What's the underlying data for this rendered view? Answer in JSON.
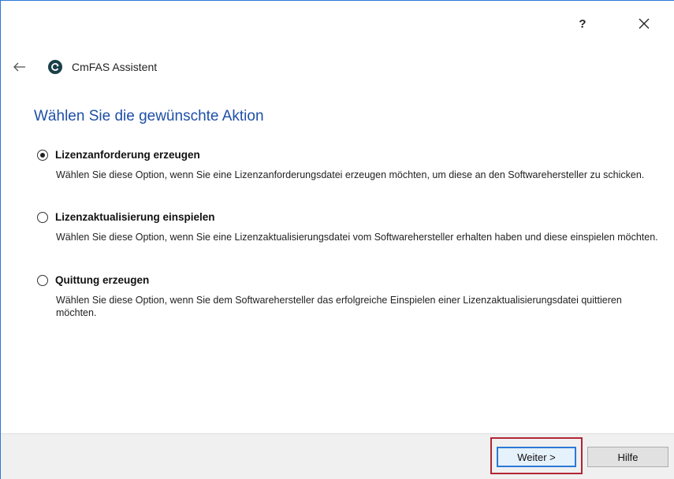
{
  "titlebar": {
    "help_label": "?",
    "close_label": "✕"
  },
  "header": {
    "back_icon": "arrow-left-icon",
    "app_title": "CmFAS Assistent",
    "logo_icon": "cmfas-logo-icon"
  },
  "page": {
    "title": "Wählen Sie die gewünschte Aktion"
  },
  "options": [
    {
      "label": "Lizenzanforderung erzeugen",
      "description": "Wählen Sie diese Option, wenn Sie eine Lizenzanforderungsdatei erzeugen möchten, um diese an den Softwarehersteller zu schicken.",
      "selected": true
    },
    {
      "label": "Lizenzaktualisierung einspielen",
      "description": "Wählen Sie diese Option, wenn Sie eine Lizenzaktualisierungsdatei vom Softwarehersteller erhalten haben und diese einspielen möchten.",
      "selected": false
    },
    {
      "label": "Quittung erzeugen",
      "description": "Wählen Sie diese Option, wenn Sie dem Softwarehersteller das erfolgreiche Einspielen einer Lizenzaktualisierungsdatei quittieren möchten.",
      "selected": false
    }
  ],
  "footer": {
    "next_label": "Weiter >",
    "help_label": "Hilfe"
  },
  "colors": {
    "title_blue": "#1e4fa8",
    "highlight_red": "#b22533",
    "focus_blue": "#2b79d8"
  }
}
